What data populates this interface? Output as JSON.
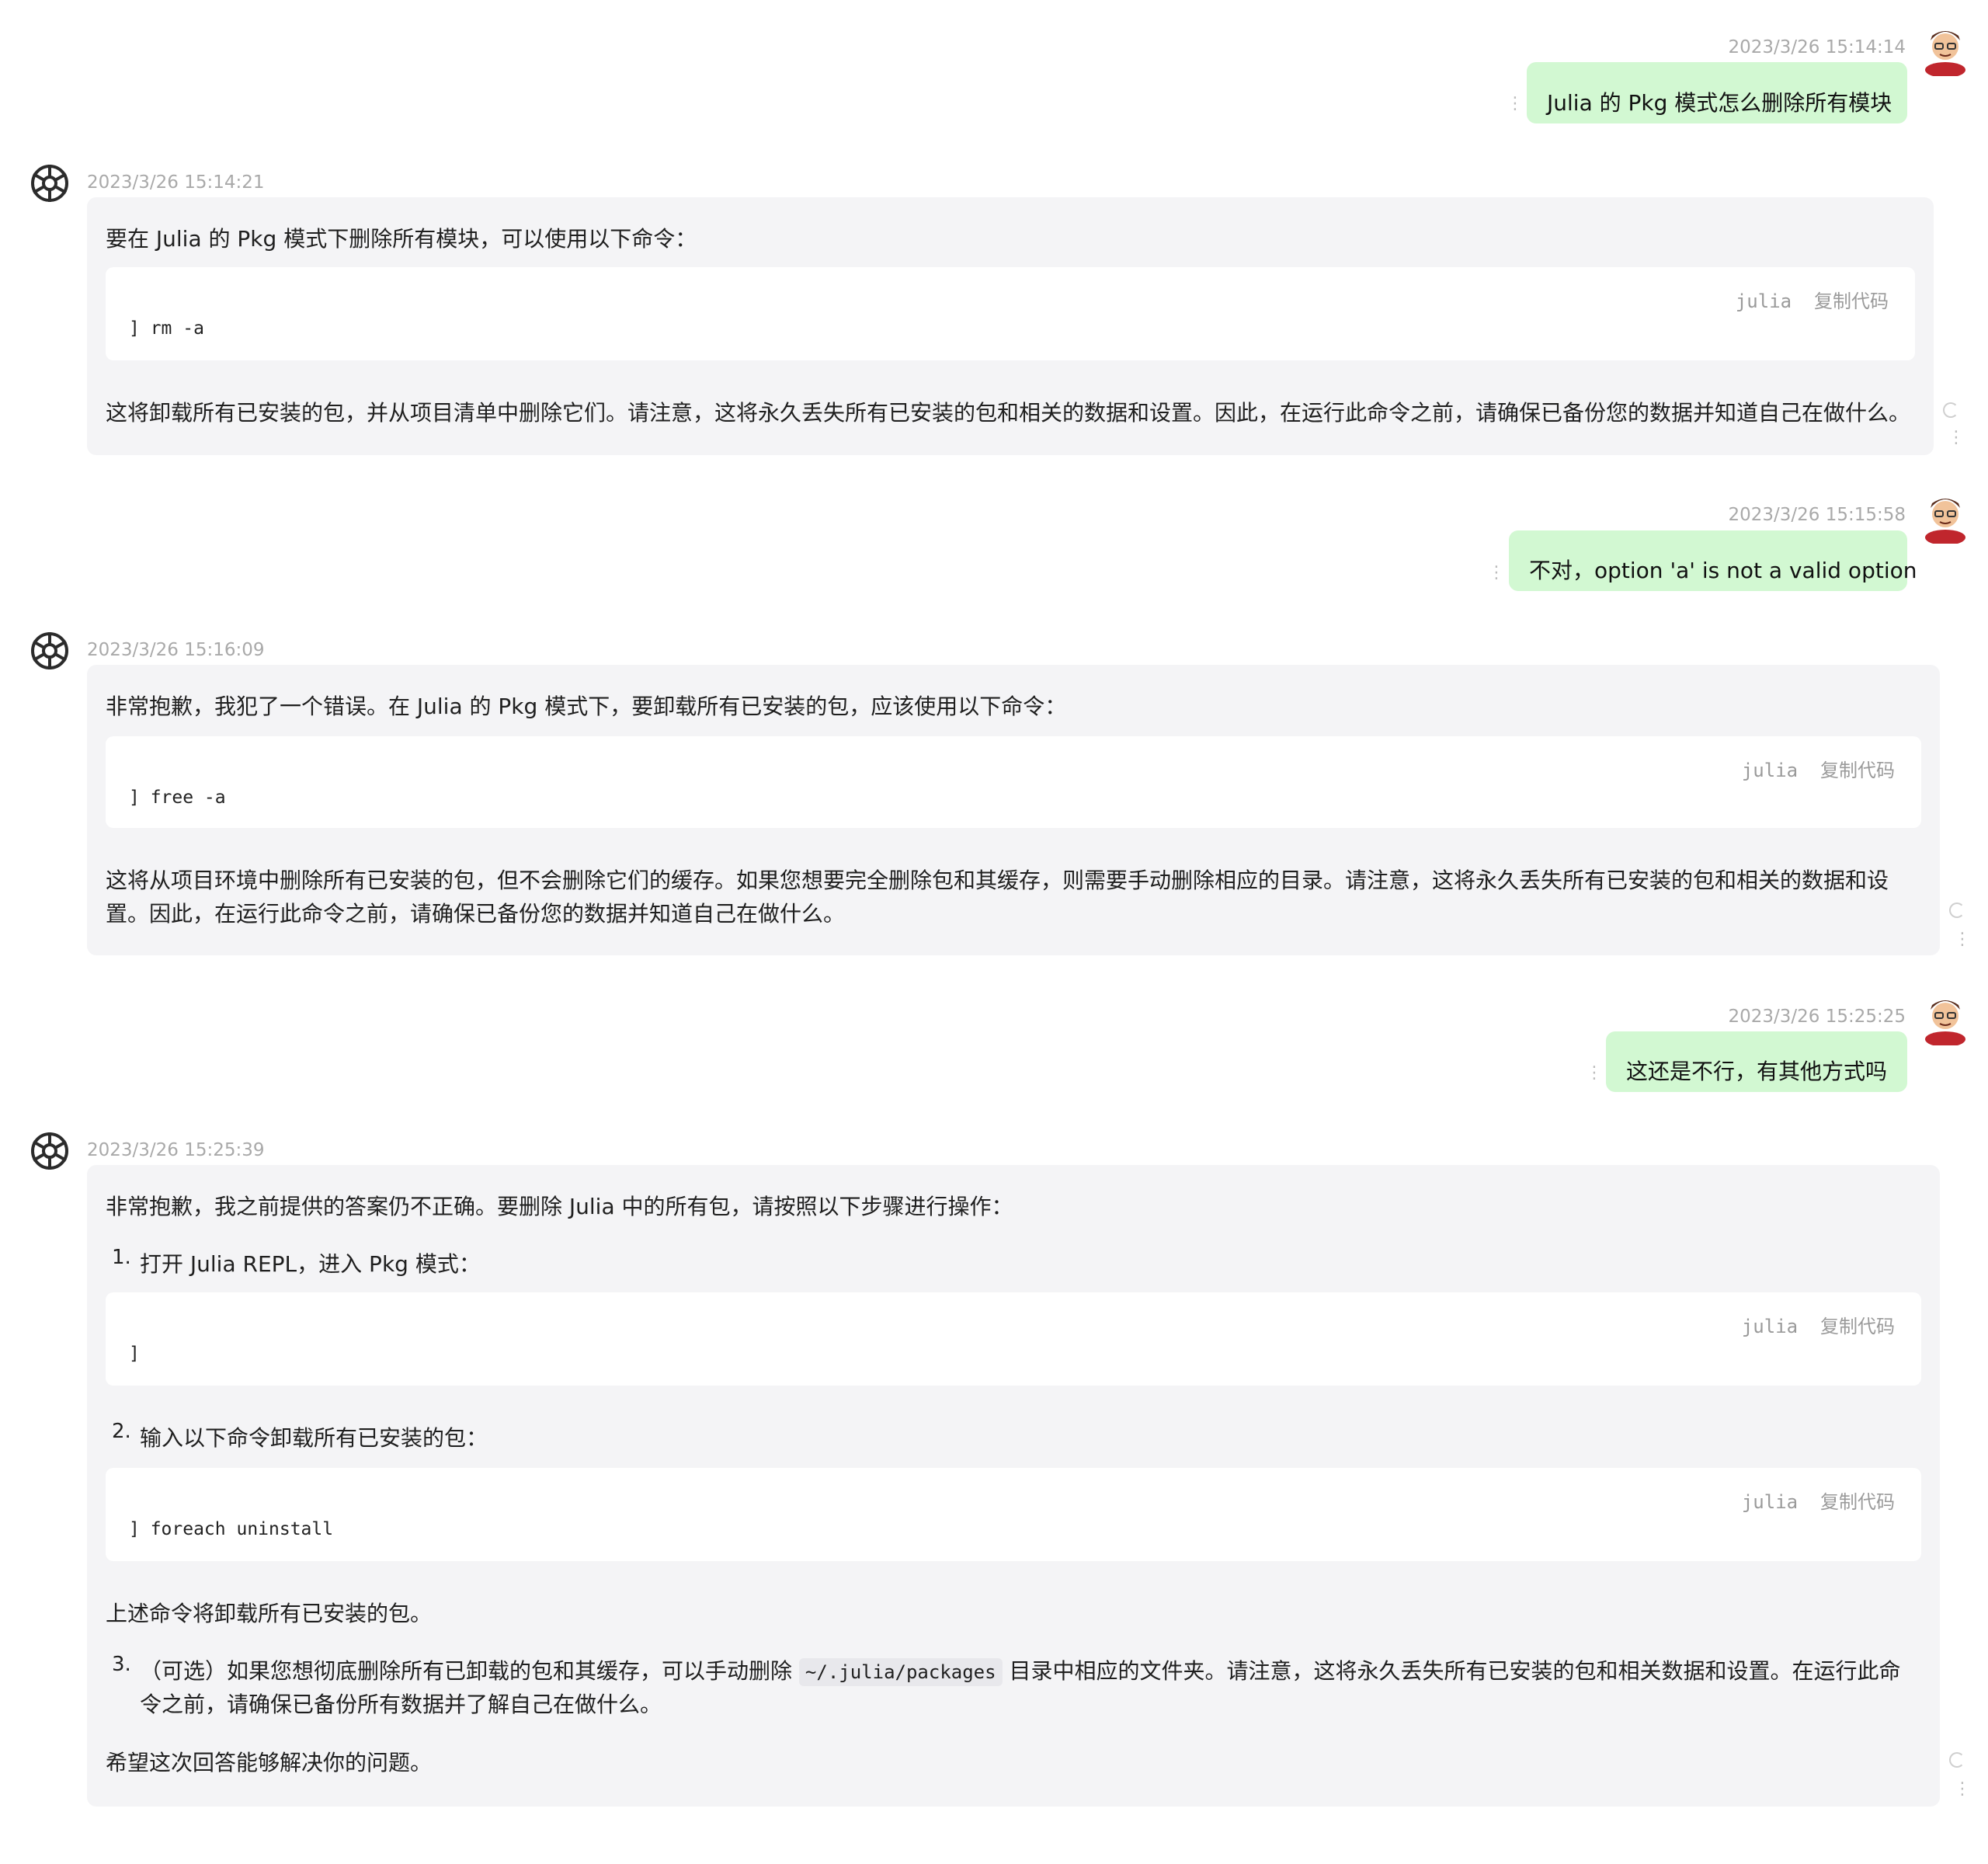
{
  "messages": [
    {
      "role": "user",
      "timestamp": "2023/3/26 15:14:14",
      "text": "Julia 的 Pkg 模式怎么删除所有模块"
    },
    {
      "role": "assistant",
      "timestamp": "2023/3/26 15:14:21",
      "intro": "要在 Julia 的 Pkg 模式下删除所有模块，可以使用以下命令：",
      "code": {
        "lang": "julia",
        "copy": "复制代码",
        "line": "] rm -a"
      },
      "outro": "这将卸载所有已安装的包，并从项目清单中删除它们。请注意，这将永久丢失所有已安装的包和相关的数据和设置。因此，在运行此命令之前，请确保已备份您的数据并知道自己在做什么。"
    },
    {
      "role": "user",
      "timestamp": "2023/3/26 15:15:58",
      "text": "不对，option 'a' is not a valid option"
    },
    {
      "role": "assistant",
      "timestamp": "2023/3/26 15:16:09",
      "intro": "非常抱歉，我犯了一个错误。在 Julia 的 Pkg 模式下，要卸载所有已安装的包，应该使用以下命令：",
      "code": {
        "lang": "julia",
        "copy": "复制代码",
        "line": "] free -a"
      },
      "outro_1": "这将从项目环境中删除所有已安装的包，但不会删除它们的缓存。如果您想要完全删除包和其缓存，则需要手动删除相应的目录。请注意，这将永久丢失所有已安装的包和相关的数据和设",
      "outro_2": "置。因此，在运行此命令之前，请确保已备份您的数据并知道自己在做什么。"
    },
    {
      "role": "user",
      "timestamp": "2023/3/26 15:25:25",
      "text": "这还是不行，有其他方式吗"
    },
    {
      "role": "assistant",
      "timestamp": "2023/3/26 15:25:39",
      "intro": "非常抱歉，我之前提供的答案仍不正确。要删除 Julia 中的所有包，请按照以下步骤进行操作：",
      "step1_num": "1.",
      "step1": "打开 Julia REPL，进入 Pkg 模式：",
      "code1": {
        "lang": "julia",
        "copy": "复制代码",
        "line": "]"
      },
      "step2_num": "2.",
      "step2": "输入以下命令卸载所有已安装的包：",
      "code2": {
        "lang": "julia",
        "copy": "复制代码",
        "line": "] foreach uninstall"
      },
      "after": "上述命令将卸载所有已安装的包。",
      "step3_num": "3.",
      "step3_a": "（可选）如果您想彻底删除所有已卸载的包和其缓存，可以手动删除",
      "step3_code": "~/.julia/packages",
      "step3_b": "目录中相应的文件夹。请注意，这将永久丢失所有已安装的包和相关数据和设置。在运行此命",
      "step3_c": "令之前，请确保已备份所有数据并了解自己在做什么。",
      "closing": "希望这次回答能够解决你的问题。"
    }
  ],
  "icons": {
    "user_avatar": "cartoon-user-avatar",
    "bot_avatar": "openai-logo-icon",
    "more": "more-vertical-icon",
    "regenerate": "refresh-icon"
  },
  "colors": {
    "user_bubble": "#d2f8d2",
    "bot_bubble": "#f4f4f6",
    "code_bg": "#ffffff",
    "timestamp": "#a9a9a9"
  }
}
